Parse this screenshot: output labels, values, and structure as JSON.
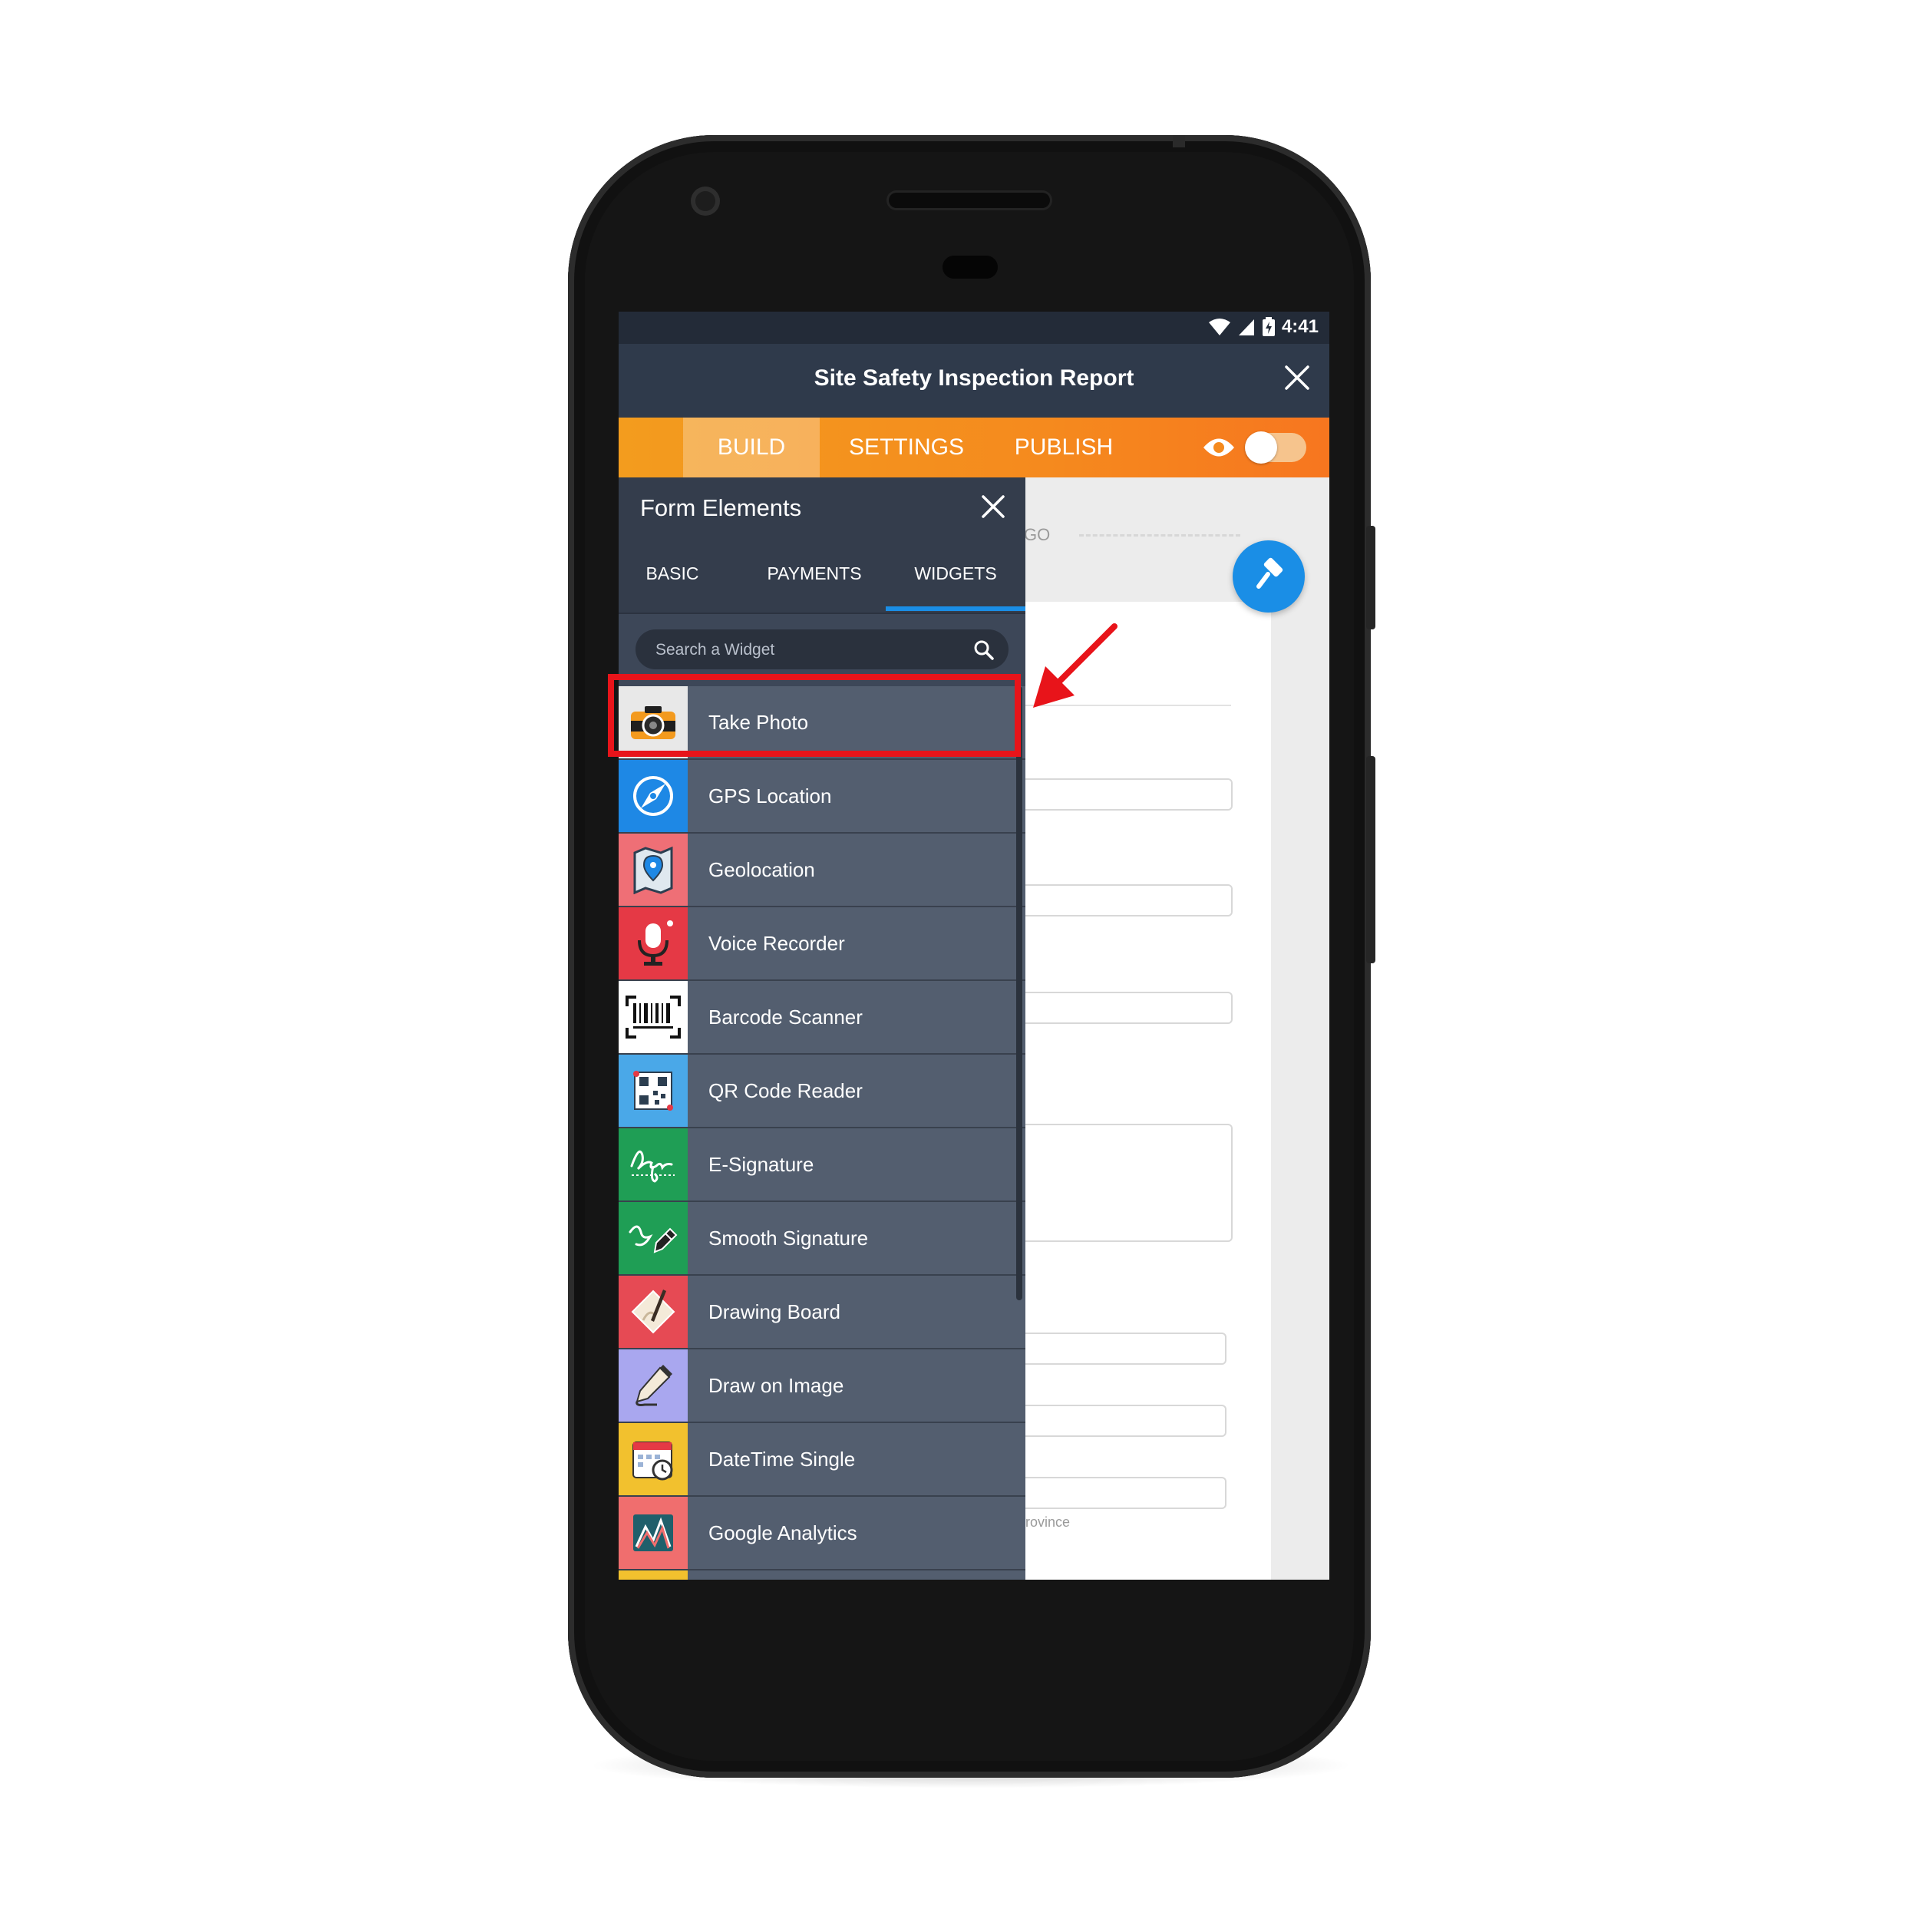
{
  "status_bar": {
    "time": "4:41"
  },
  "header": {
    "title": "Site Safety Inspection Report"
  },
  "tabs": [
    {
      "label": "BUILD",
      "active": true
    },
    {
      "label": "SETTINGS",
      "active": false
    },
    {
      "label": "PUBLISH",
      "active": false
    }
  ],
  "preview_toggle": {
    "on": false
  },
  "panel": {
    "title": "Form Elements",
    "subtabs": [
      {
        "label": "BASIC",
        "active": false
      },
      {
        "label": "PAYMENTS",
        "active": false
      },
      {
        "label": "WIDGETS",
        "active": true
      }
    ],
    "search": {
      "placeholder": "Search a Widget"
    },
    "widgets": [
      {
        "label": "Take Photo",
        "icon": "camera-icon",
        "color": "#e8e8e8"
      },
      {
        "label": "GPS Location",
        "icon": "compass-icon",
        "color": "#1e88e5"
      },
      {
        "label": "Geolocation",
        "icon": "map-pin-icon",
        "color": "#ef6f76"
      },
      {
        "label": "Voice Recorder",
        "icon": "microphone-icon",
        "color": "#e53945"
      },
      {
        "label": "Barcode Scanner",
        "icon": "barcode-icon",
        "color": "#ffffff"
      },
      {
        "label": "QR Code Reader",
        "icon": "qr-code-icon",
        "color": "#4aa8e8"
      },
      {
        "label": "E-Signature",
        "icon": "signature-icon",
        "color": "#1f9e55"
      },
      {
        "label": "Smooth Signature",
        "icon": "pen-nib-icon",
        "color": "#1f9e55"
      },
      {
        "label": "Drawing Board",
        "icon": "drawing-board-icon",
        "color": "#e64a54"
      },
      {
        "label": "Draw on Image",
        "icon": "pencil-icon",
        "color": "#a9a7ef"
      },
      {
        "label": "DateTime Single",
        "icon": "calendar-clock-icon",
        "color": "#f2c12e"
      },
      {
        "label": "Google Analytics",
        "icon": "analytics-chart-icon",
        "color": "#f06e6e"
      },
      {
        "label": "",
        "icon": "partial-widget-icon",
        "color": "#f2c12e"
      }
    ]
  },
  "form_preview": {
    "text_go": "GO",
    "text_province": "rovince"
  },
  "colors": {
    "accent": "#1a8ee6",
    "tabs_orange": "#f58a1e",
    "highlight": "#e8141a"
  }
}
